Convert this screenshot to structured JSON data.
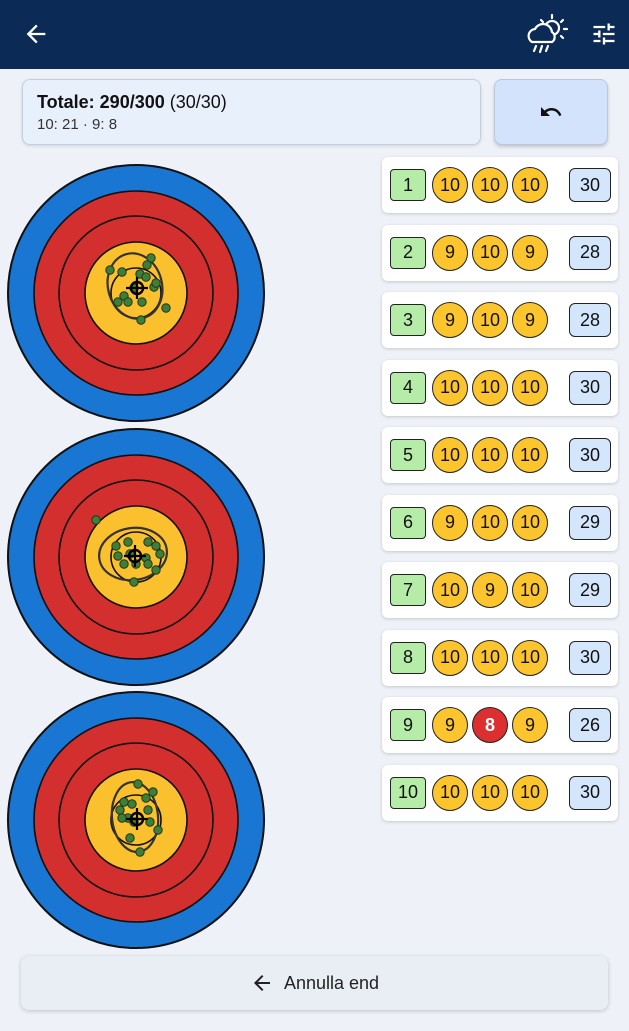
{
  "appbar": {
    "back_icon": "arrow-left-icon",
    "weather_icon": "cloud-sun-rain-icon",
    "settings_icon": "tune-sliders-icon"
  },
  "summary": {
    "total_label": "Totale: 290/300",
    "x_count": "(30/30)",
    "breakdown": "10: 21 · 9: 8"
  },
  "undo_icon": "undo-icon",
  "ends": [
    {
      "num": "1",
      "arrows": [
        "10",
        "10",
        "10"
      ],
      "sum": "30"
    },
    {
      "num": "2",
      "arrows": [
        "9",
        "10",
        "9"
      ],
      "sum": "28"
    },
    {
      "num": "3",
      "arrows": [
        "9",
        "10",
        "9"
      ],
      "sum": "28"
    },
    {
      "num": "4",
      "arrows": [
        "10",
        "10",
        "10"
      ],
      "sum": "30"
    },
    {
      "num": "5",
      "arrows": [
        "10",
        "10",
        "10"
      ],
      "sum": "30"
    },
    {
      "num": "6",
      "arrows": [
        "9",
        "10",
        "10"
      ],
      "sum": "29"
    },
    {
      "num": "7",
      "arrows": [
        "10",
        "9",
        "10"
      ],
      "sum": "29"
    },
    {
      "num": "8",
      "arrows": [
        "10",
        "10",
        "10"
      ],
      "sum": "30"
    },
    {
      "num": "9",
      "arrows": [
        "9",
        "8",
        "9"
      ],
      "sum": "26"
    },
    {
      "num": "10",
      "arrows": [
        "10",
        "10",
        "10"
      ],
      "sum": "30"
    }
  ],
  "colors": {
    "appbar": "#0b2a55",
    "ring_blue": "#1976d2",
    "ring_red": "#d32f2f",
    "ring_gold": "#fbc02d",
    "score_gold": "#fcc52e",
    "score_red": "#dc2f2f",
    "end_num": "#b5eca8",
    "end_sum": "#d3e6fb"
  },
  "footer": {
    "annulla_label": "Annulla end"
  }
}
